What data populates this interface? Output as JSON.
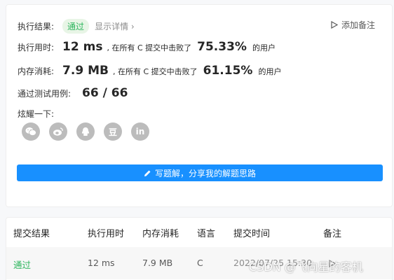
{
  "result": {
    "label": "执行结果:",
    "status_badge": "通过",
    "details_link": "显示详情 ›",
    "add_note": "添加备注"
  },
  "runtime": {
    "label": "执行用时:",
    "value": "12 ms",
    "beat_prefix": ", 在所有 C 提交中击败了",
    "percent": "75.33%",
    "beat_suffix": "的用户"
  },
  "memory": {
    "label": "内存消耗:",
    "value": "7.9 MB",
    "beat_prefix": ", 在所有 C 提交中击败了",
    "percent": "61.15%",
    "beat_suffix": "的用户"
  },
  "testcases": {
    "label": "通过测试用例:",
    "value": "66 / 66"
  },
  "share": {
    "label": "炫耀一下:",
    "icons": [
      "wechat-icon",
      "weibo-icon",
      "qq-icon",
      "douban-icon",
      "linkedin-icon"
    ],
    "douban_glyph": "豆",
    "linkedin_glyph": "in"
  },
  "write_solution_button": "写题解，分享我的解题思路",
  "table": {
    "headers": [
      "提交结果",
      "执行用时",
      "内存消耗",
      "语言",
      "提交时间",
      "备注"
    ],
    "rows": [
      {
        "status": "通过",
        "runtime": "12 ms",
        "memory": "7.9 MB",
        "language": "C",
        "time": "2022/07/25 15:30"
      }
    ]
  },
  "watermark": "CSDN @飞向星的客机",
  "colors": {
    "accent": "#1890ff",
    "success": "#2db55d",
    "icon_gray": "#bcbcbc"
  }
}
